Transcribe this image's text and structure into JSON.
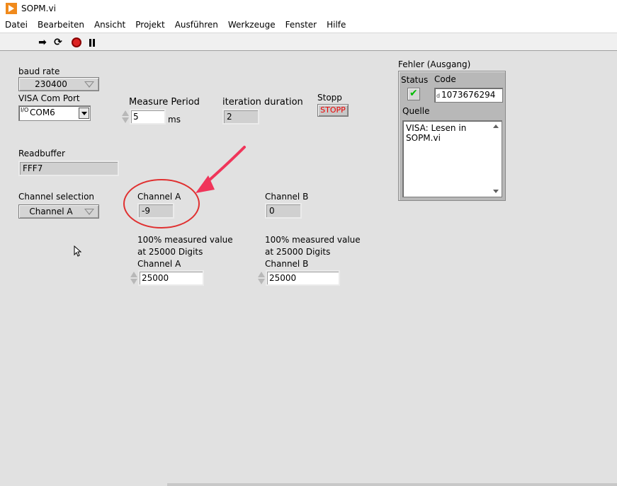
{
  "window": {
    "title": "SOPM.vi"
  },
  "menu": [
    "Datei",
    "Bearbeiten",
    "Ansicht",
    "Projekt",
    "Ausführen",
    "Werkzeuge",
    "Fenster",
    "Hilfe"
  ],
  "toolbar": {
    "run_icon": "run-arrow-icon",
    "run_continuous_icon": "run-continuously-icon",
    "abort_icon": "abort-execution-icon",
    "pause_icon": "pause-icon"
  },
  "panel": {
    "baud_rate": {
      "label": "baud rate",
      "value": "230400"
    },
    "visa": {
      "label": "VISA Com Port",
      "io_glyph": "I/O",
      "value": "COM6"
    },
    "measure_period": {
      "label": "Measure Period",
      "value": "5",
      "unit": "ms"
    },
    "iteration_duration": {
      "label": "iteration duration",
      "value": "2"
    },
    "stopp": {
      "label": "Stopp",
      "button": "STOPP"
    },
    "readbuffer": {
      "label": "Readbuffer",
      "value": "FFF7"
    },
    "channel_selection": {
      "label": "Channel selection",
      "value": "Channel A"
    },
    "channel_a": {
      "label": "Channel A",
      "value": "-9"
    },
    "channel_b": {
      "label": "Channel B",
      "value": "0"
    },
    "scale_a": {
      "label_line1": "100% measured value",
      "label_line2": "at 25000 Digits",
      "label_line3": "Channel A",
      "value": "25000"
    },
    "scale_b": {
      "label_line1": "100% measured value",
      "label_line2": "at 25000 Digits",
      "label_line3": "Channel B",
      "value": "25000"
    }
  },
  "error_cluster": {
    "title": "Fehler (Ausgang)",
    "status_label": "Status",
    "code_label": "Code",
    "code_radix": "d",
    "code_value": "1073676294",
    "source_label": "Quelle",
    "source_line1": "VISA: Lesen in",
    "source_line2": "SOPM.vi"
  },
  "colors": {
    "panel_bg": "#e1e1e1",
    "stop_text": "#e00000",
    "annotation": "#f0355a",
    "circle": "#e03030",
    "status_check": "#00bb00"
  }
}
